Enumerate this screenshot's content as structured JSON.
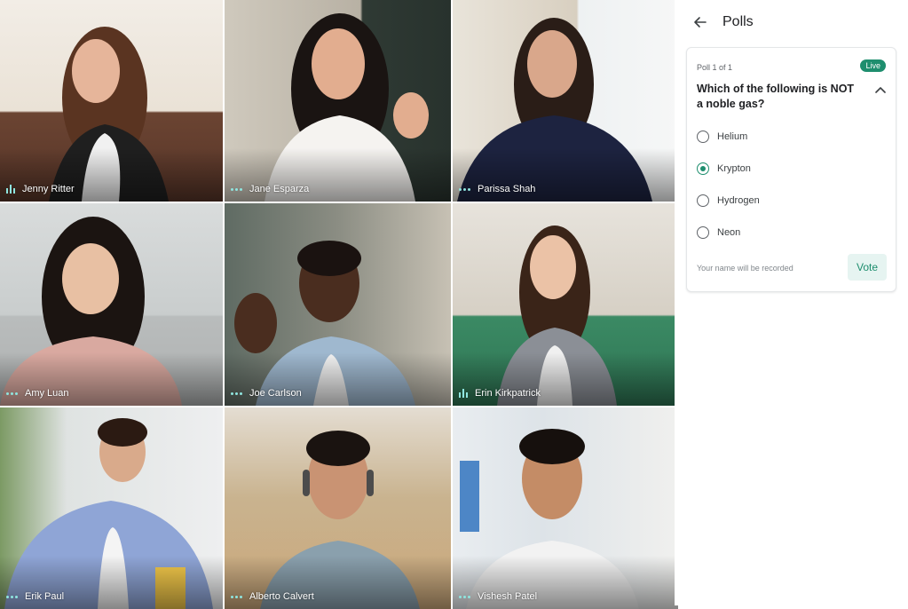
{
  "participants": [
    {
      "name": "Jenny Ritter",
      "mic": "speaking-icon"
    },
    {
      "name": "Jane Esparza",
      "mic": "muted-dots-icon"
    },
    {
      "name": "Parissa Shah",
      "mic": "muted-dots-icon"
    },
    {
      "name": "Amy Luan",
      "mic": "muted-dots-icon"
    },
    {
      "name": "Joe Carlson",
      "mic": "muted-dots-icon"
    },
    {
      "name": "Erin Kirkpatrick",
      "mic": "speaking-icon"
    },
    {
      "name": "Erik Paul",
      "mic": "muted-dots-icon"
    },
    {
      "name": "Alberto Calvert",
      "mic": "muted-dots-icon"
    },
    {
      "name": "Vishesh Patel",
      "mic": "muted-dots-icon"
    }
  ],
  "panel": {
    "title": "Polls",
    "back_icon": "arrow-left-icon"
  },
  "poll": {
    "count": "Poll 1 of 1",
    "status": "Live",
    "question": "Which of the following is NOT a noble gas?",
    "options": [
      {
        "label": "Helium",
        "selected": false
      },
      {
        "label": "Krypton",
        "selected": true
      },
      {
        "label": "Hydrogen",
        "selected": false
      },
      {
        "label": "Neon",
        "selected": false
      }
    ],
    "note": "Your name will be recorded",
    "vote_label": "Vote"
  },
  "colors": {
    "accent": "#1e8e6e",
    "mic_indicator": "#8fe5df",
    "vote_bg": "#e6f4f1"
  }
}
